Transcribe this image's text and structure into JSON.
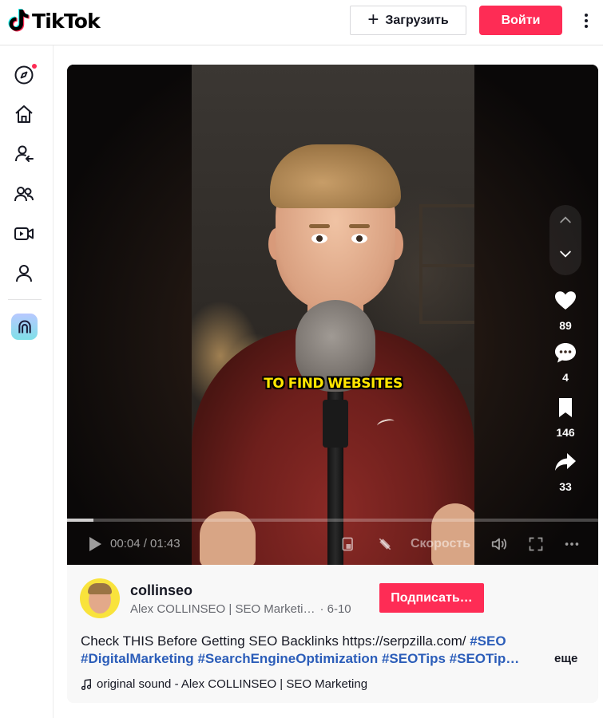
{
  "header": {
    "logo_text": "TikTok",
    "upload_label": "Загрузить",
    "login_label": "Войти"
  },
  "sidebar": {
    "items": [
      {
        "icon": "compass-icon",
        "has_notification_dot": true
      },
      {
        "icon": "home-icon"
      },
      {
        "icon": "following-icon"
      },
      {
        "icon": "friends-icon"
      },
      {
        "icon": "live-video-icon"
      },
      {
        "icon": "profile-icon"
      },
      {
        "icon": "live-studio-icon"
      }
    ]
  },
  "video": {
    "caption_overlay": "TO FIND WEBSITES",
    "likes": "89",
    "comments": "4",
    "saves": "146",
    "shares": "33",
    "current_time": "00:04",
    "duration": "01:43",
    "time_display": "00:04 / 01:43",
    "progress_fraction": 0.05,
    "speed_label": "Скорость"
  },
  "author": {
    "username": "collinseo",
    "display_name": "Alex COLLINSEO | SEO Marketi…",
    "date": "· 6-10",
    "follow_label": "Подписать…"
  },
  "description": {
    "text": "Check THIS Before Getting SEO Backlinks https://serpzilla.com/",
    "hashtags": [
      "#SEO",
      "#DigitalMarketing",
      "#SearchEngineOptimization",
      "#SEOTips",
      "#SEOTip…"
    ],
    "more_label": "еще"
  },
  "sound": {
    "label": "original sound - Alex COLLINSEO | SEO Marketing"
  },
  "colors": {
    "brand_red": "#fe2c55",
    "hashtag_blue": "#2b5db9",
    "caption_yellow": "#ffe600"
  }
}
